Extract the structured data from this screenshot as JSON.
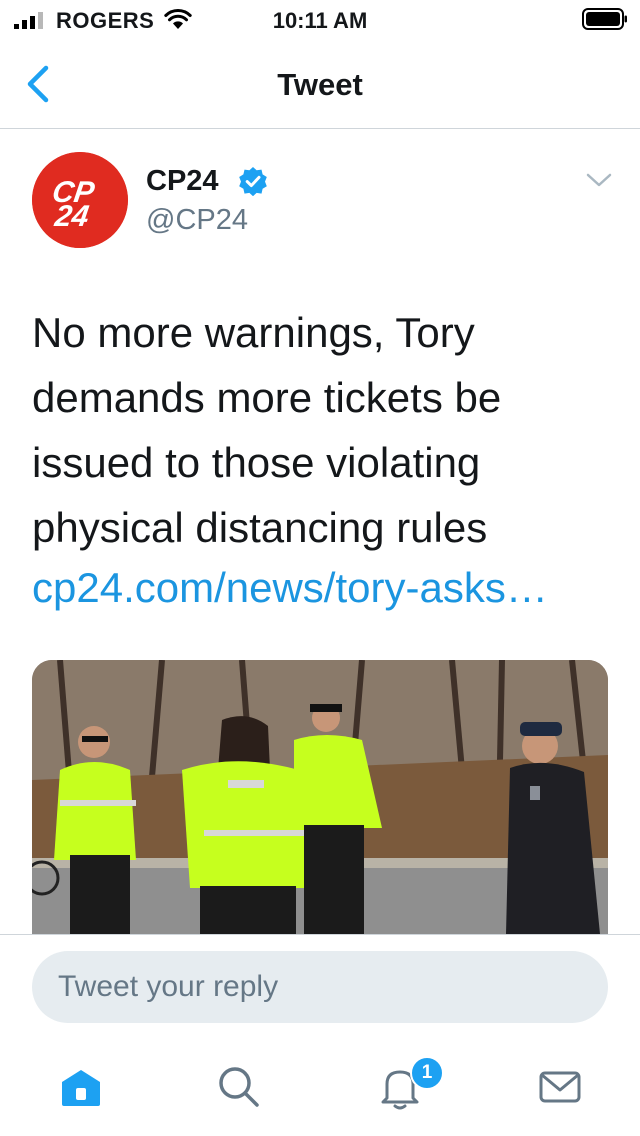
{
  "status_bar": {
    "carrier": "ROGERS",
    "time": "10:11 AM"
  },
  "nav": {
    "title": "Tweet"
  },
  "tweet": {
    "author_name": "CP24",
    "author_handle": "@CP24",
    "avatar_logo_text": "CP 24",
    "text": "No more warnings, Tory demands more tickets be issued to those violating physical distancing rules",
    "link": "cp24.com/news/tory-asks…"
  },
  "reply": {
    "placeholder": "Tweet your reply"
  },
  "tab_bar": {
    "items": [
      "home-icon",
      "search-icon",
      "notifications-icon",
      "messages-icon"
    ],
    "notifications_badge": "1"
  },
  "colors": {
    "accent": "#1da1f2",
    "link": "#1b95e0",
    "brand_red": "#e02b20",
    "secondary_text": "#657786",
    "divider": "#cfd5da",
    "reply_bg": "#e6ecf0"
  }
}
